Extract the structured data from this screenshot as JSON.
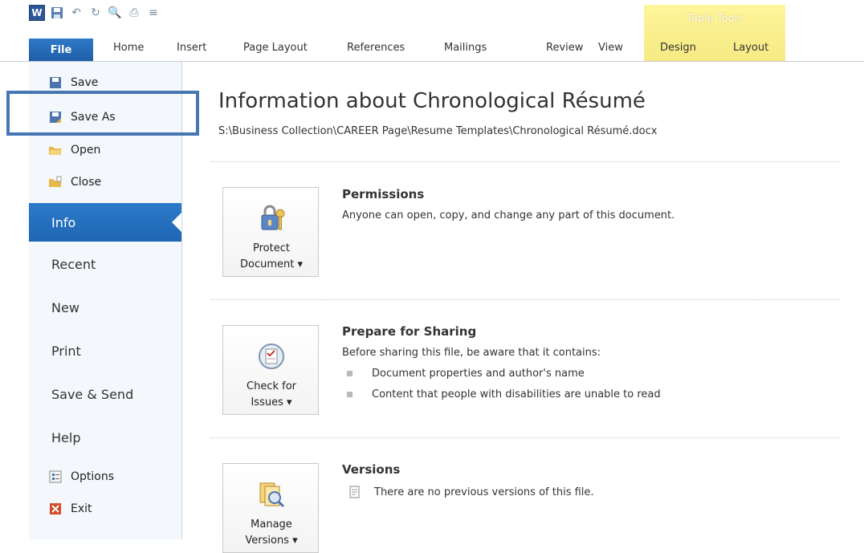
{
  "qat": {
    "icons": [
      "word-icon",
      "save-icon",
      "undo-icon",
      "redo-icon",
      "print-preview-icon",
      "quick-print-icon",
      "customize-icon"
    ]
  },
  "ribbon": {
    "file_tab": "File",
    "tabs": [
      "Home",
      "Insert",
      "Page Layout",
      "References",
      "Mailings",
      "Review",
      "View",
      "Design",
      "Layout"
    ],
    "context_title": "Table Tools",
    "context_color": "#f6ea84",
    "file_color": "#1f5ea6"
  },
  "backstage_nav": {
    "commands": [
      {
        "label": "Save",
        "icon": "save-icon"
      },
      {
        "label": "Save As",
        "icon": "save-as-icon"
      },
      {
        "label": "Open",
        "icon": "open-folder-icon"
      },
      {
        "label": "Close",
        "icon": "close-folder-icon"
      }
    ],
    "sections": [
      "Info",
      "Recent",
      "New",
      "Print",
      "Save & Send",
      "Help"
    ],
    "selected": "Info",
    "bottom": [
      {
        "label": "Options",
        "icon": "options-icon"
      },
      {
        "label": "Exit",
        "icon": "exit-icon"
      }
    ],
    "highlight_color": "#4676b3"
  },
  "info": {
    "title": "Information about Chronological Résumé",
    "path": "S:\\Business Collection\\CAREER Page\\Resume Templates\\Chronological Résumé.docx",
    "permissions": {
      "button_line1": "Protect",
      "button_line2": "Document ▾",
      "heading": "Permissions",
      "text": "Anyone can open, copy, and change any part of this document."
    },
    "sharing": {
      "button_line1": "Check for",
      "button_line2": "Issues ▾",
      "heading": "Prepare for Sharing",
      "text": "Before sharing this file, be aware that it contains:",
      "bullets": [
        "Document properties and author's name",
        "Content that people with disabilities are unable to read"
      ]
    },
    "versions": {
      "button_line1": "Manage",
      "button_line2": "Versions ▾",
      "heading": "Versions",
      "text": "There are no previous versions of this file."
    }
  }
}
